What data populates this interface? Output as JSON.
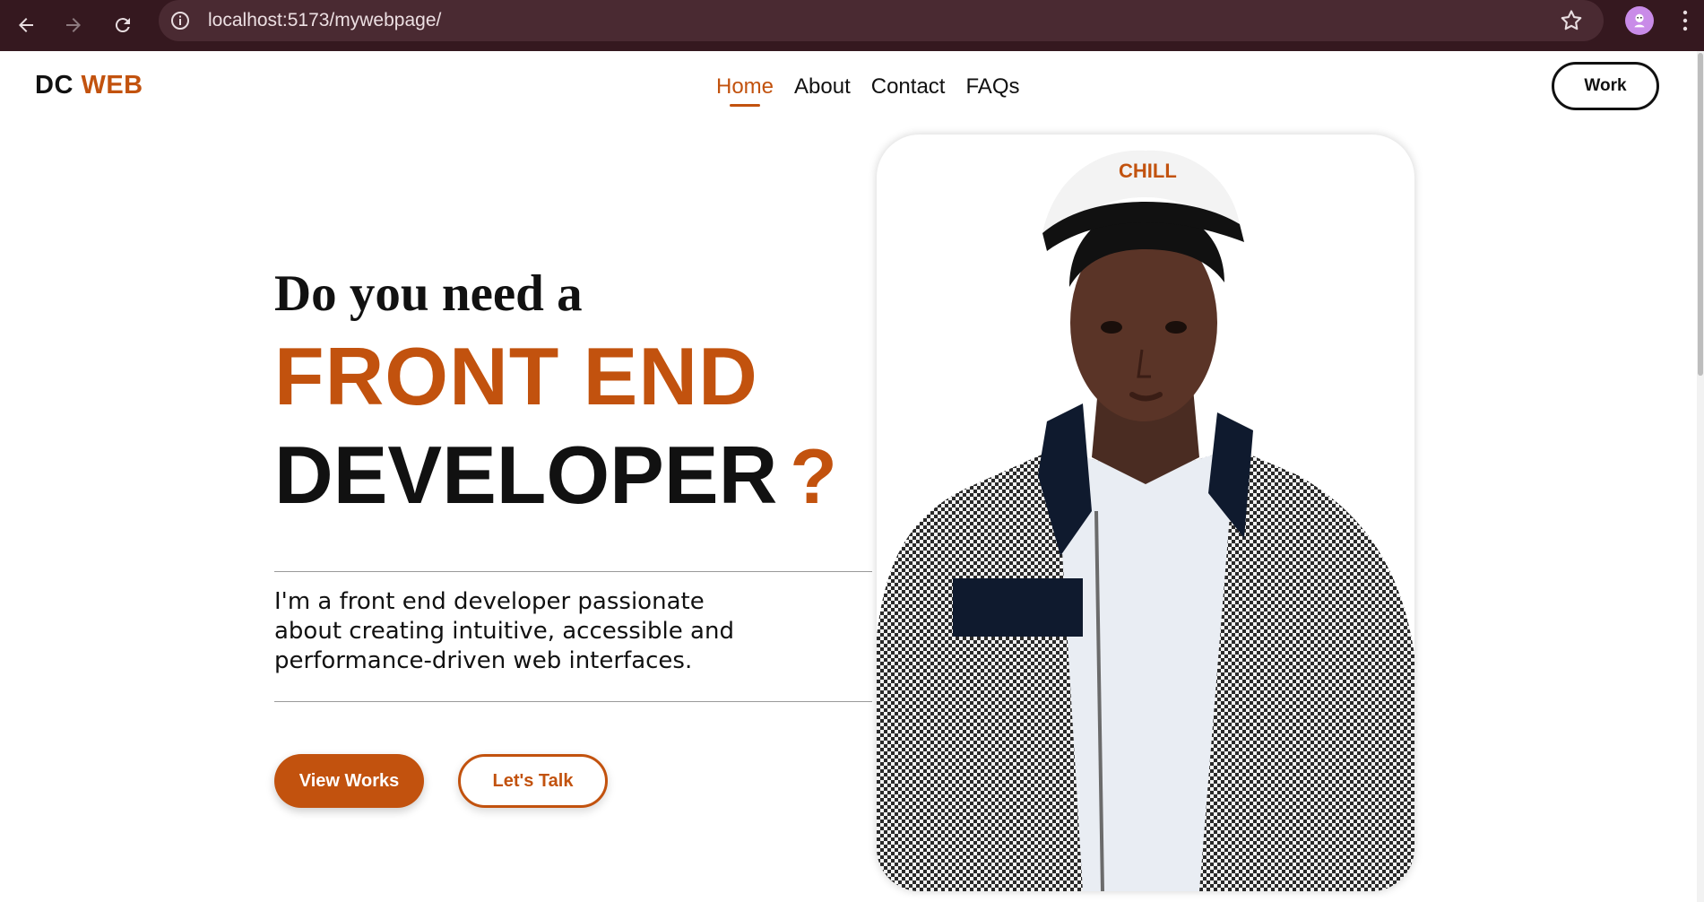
{
  "browser": {
    "url": "localhost:5173/mywebpage/",
    "icons": [
      "back-icon",
      "forward-icon",
      "reload-icon",
      "info-icon",
      "star-icon",
      "profile-avatar",
      "menu-icon"
    ]
  },
  "header": {
    "logo_primary": "DC",
    "logo_accent": "WEB",
    "nav": [
      {
        "label": "Home",
        "active": true
      },
      {
        "label": "About",
        "active": false
      },
      {
        "label": "Contact",
        "active": false
      },
      {
        "label": "FAQs",
        "active": false
      }
    ],
    "work_button": "Work"
  },
  "hero": {
    "line1": "Do you need a",
    "line2": "FRONT END",
    "line3": "DEVELOPER",
    "question_mark": "?",
    "description": "I'm a front end developer passionate about creating intuitive, accessible and performance-driven web interfaces.",
    "primary_button": "View Works",
    "secondary_button": "Let's Talk"
  },
  "photo": {
    "cap_text": "CHILL"
  },
  "colors": {
    "accent": "#c2520e",
    "text": "#111111",
    "browser_frame": "#35181f"
  }
}
